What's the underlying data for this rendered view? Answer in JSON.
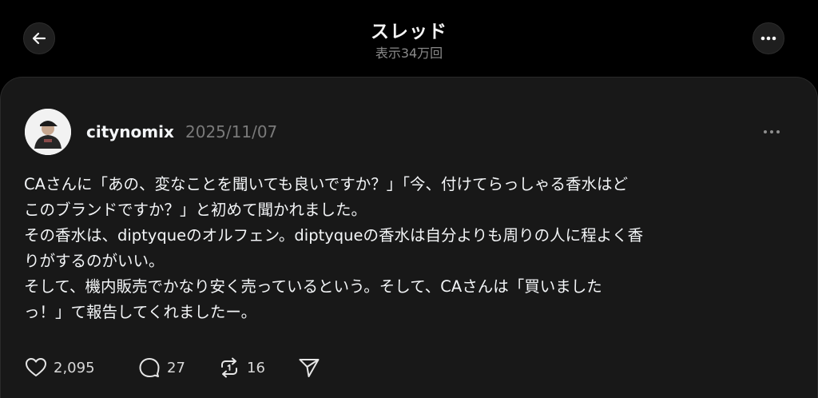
{
  "header": {
    "title": "スレッド",
    "views": "表示34万回"
  },
  "post": {
    "username": "citynomix",
    "date": "2025/11/07",
    "lines": [
      "CAさんに「あの、変なことを聞いても良いですか？」「今、付けてらっしゃる香水はど",
      "このブランドですか？」と初めて聞かれました。",
      "その香水は、diptyqueのオルフェン。diptyqueの香水は自分よりも周りの人に程よく香",
      "りがするのがいい。",
      "そして、機内販売でかなり安く売っているという。そして、CAさんは「買いました",
      "っ！」て報告してくれましたー。"
    ],
    "likes": "2,095",
    "replies": "27",
    "reposts": "16"
  },
  "icons": {
    "back": "arrow-left-icon",
    "more": "more-horizontal-icon",
    "like": "heart-icon",
    "reply": "comment-icon",
    "repost": "repost-icon",
    "share": "send-icon"
  },
  "colors": {
    "background": "#000000",
    "card": "#181818",
    "text": "#f3f5f7",
    "muted": "#7a7a7a"
  }
}
